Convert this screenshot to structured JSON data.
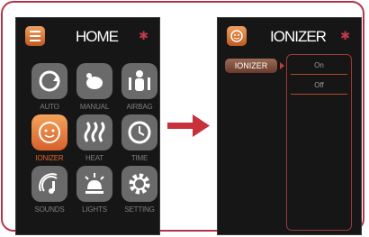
{
  "home": {
    "title": "HOME",
    "bluetooth_icon": "bluetooth-icon",
    "menu_icon": "menu-list-icon",
    "items": [
      {
        "label": "AUTO",
        "icon": "auto-cycle-icon",
        "active": false
      },
      {
        "label": "MANUAL",
        "icon": "manual-hand-icon",
        "active": false
      },
      {
        "label": "AIRBAG",
        "icon": "airbag-body-icon",
        "active": false
      },
      {
        "label": "IONIZER",
        "icon": "ionizer-icon",
        "active": true
      },
      {
        "label": "HEAT",
        "icon": "heat-waves-icon",
        "active": false
      },
      {
        "label": "TIME",
        "icon": "clock-icon",
        "active": false
      },
      {
        "label": "SOUNDS",
        "icon": "sound-icon",
        "active": false
      },
      {
        "label": "LIGHTS",
        "icon": "light-icon",
        "active": false
      },
      {
        "label": "SETTING",
        "icon": "gear-icon",
        "active": false
      }
    ]
  },
  "ionizer": {
    "title": "IONIZER",
    "selected_tab": "IONIZER",
    "options": [
      "On",
      "Off"
    ]
  },
  "colors": {
    "accent": "#e2622d",
    "frame": "#b6344a",
    "screen_bg": "#161616",
    "arrow": "#c8303a"
  }
}
